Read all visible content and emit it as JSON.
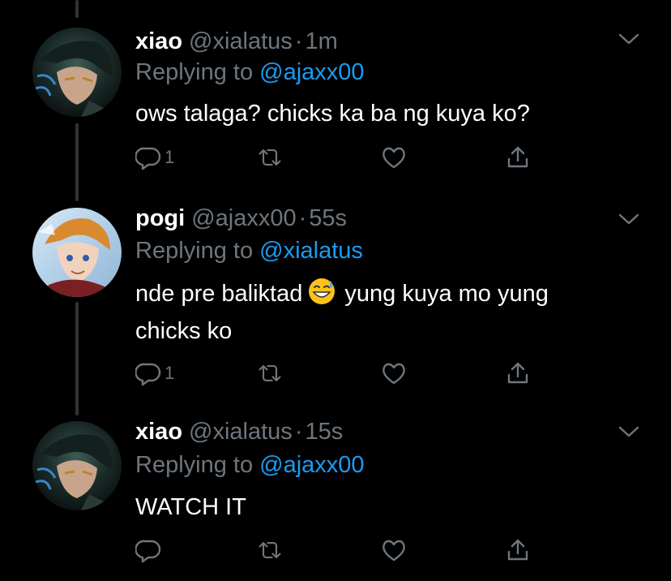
{
  "tweets": [
    {
      "name": "xiao",
      "handle": "@xialatus",
      "dot": "·",
      "time": "1m",
      "replying_prefix": "Replying to",
      "replying_handle": "@ajaxx00",
      "text": "ows talaga? chicks ka ba ng kuya ko?",
      "reply_count": "1",
      "avatar": "xiao-avatar"
    },
    {
      "name": "pogi",
      "handle": "@ajaxx00",
      "dot": "·",
      "time": "55s",
      "replying_prefix": "Replying to",
      "replying_handle": "@xialatus",
      "text_before_emoji": "nde pre baliktad",
      "emoji": "grinning-sweat-emoji",
      "text_after_emoji": "yung kuya mo yung",
      "text_line2": "chicks ko",
      "reply_count": "1",
      "avatar": "pogi-avatar"
    },
    {
      "name": "xiao",
      "handle": "@xialatus",
      "dot": "·",
      "time": "15s",
      "replying_prefix": "Replying to",
      "replying_handle": "@ajaxx00",
      "text": "WATCH IT",
      "reply_count": "",
      "avatar": "xiao-avatar"
    }
  ],
  "icons": {
    "reply": "reply-icon",
    "retweet": "retweet-icon",
    "like": "heart-icon",
    "share": "share-icon",
    "more": "chevron-down-icon"
  },
  "colors": {
    "background": "#000000",
    "secondary_text": "#6e767d",
    "mention": "#1d9bf0",
    "thread_line": "#2f3336"
  }
}
